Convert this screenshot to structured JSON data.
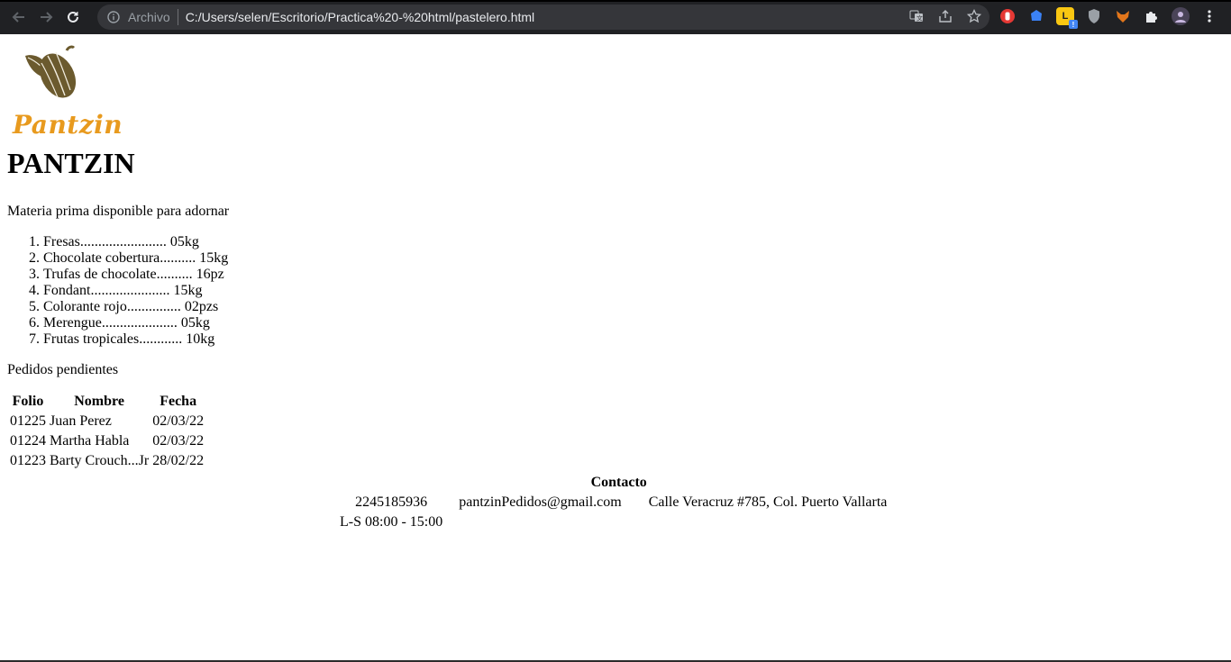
{
  "browser": {
    "address_prefix": "Archivo",
    "url": "C:/Users/selen/Escritorio/Practica%20-%20html/pastelero.html"
  },
  "brand": {
    "logo_text": "Pantzin",
    "logo_color": "#e89a1e",
    "cacao_color": "#6b5a2e"
  },
  "heading": "PANTZIN",
  "intro": "Materia prima disponible para adornar",
  "materia": [
    "Fresas........................ 05kg",
    "Chocolate cobertura.......... 15kg",
    "Trufas de chocolate.......... 16pz",
    "Fondant...................... 15kg",
    "Colorante rojo............... 02pzs",
    "Merengue..................... 05kg",
    "Frutas tropicales............ 10kg"
  ],
  "pending_title": "Pedidos pendientes",
  "pedidos": {
    "headers": [
      "Folio",
      "Nombre",
      "Fecha"
    ],
    "rows": [
      [
        "01225",
        "Juan Perez",
        "02/03/22"
      ],
      [
        "01224",
        "Martha Habla",
        "02/03/22"
      ],
      [
        "01223",
        "Barty Crouch...Jr",
        "28/02/22"
      ]
    ]
  },
  "contacto": {
    "title": "Contacto",
    "phone": "2245185936",
    "email": "pantzinPedidos@gmail.com",
    "address": "Calle Veracruz #785, Col. Puerto Vallarta",
    "hours": "L-S 08:00 - 15:00"
  }
}
